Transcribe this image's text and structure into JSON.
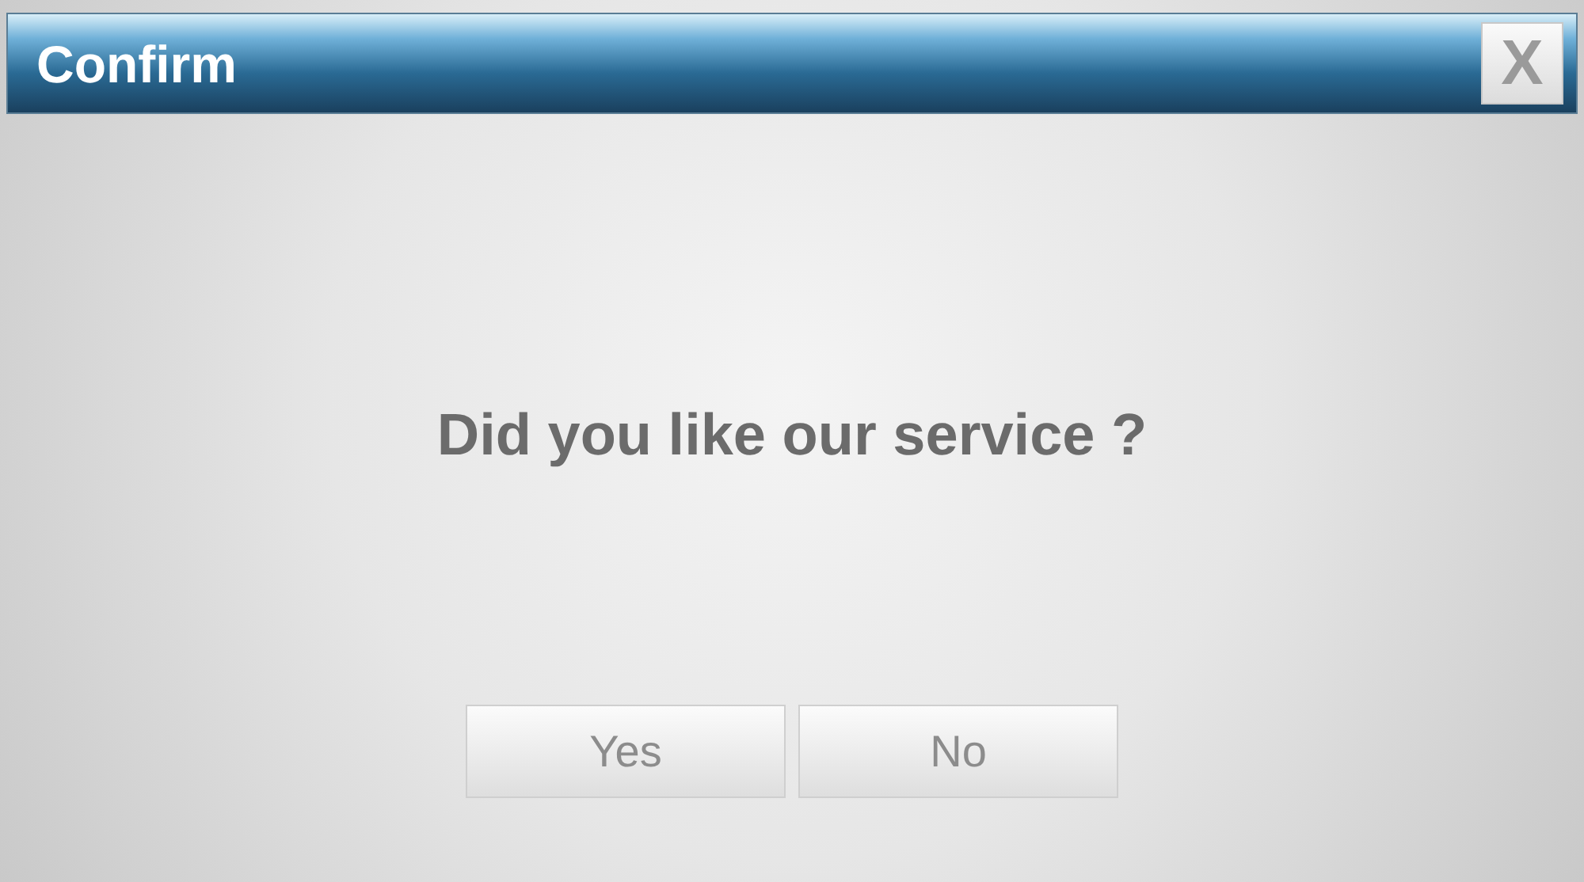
{
  "window": {
    "title": "Confirm",
    "close_label": "X"
  },
  "message": "Did you like our service ?",
  "buttons": [
    "Yes",
    "No"
  ]
}
